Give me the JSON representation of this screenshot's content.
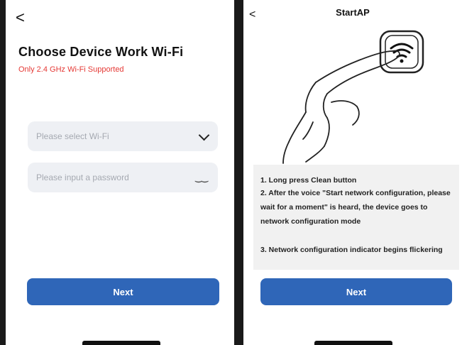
{
  "left_screen": {
    "back_label": "<",
    "title": "Choose Device Work Wi-Fi",
    "warning": "Only 2.4 GHz Wi-Fi Supported",
    "wifi_placeholder": "Please select Wi-Fi",
    "password_placeholder": "Please input a password",
    "eye_glyph": "‿‿",
    "next_label": "Next"
  },
  "right_screen": {
    "back_label": "<",
    "title": "StartAP",
    "instructions": [
      "1. Long press Clean button",
      "2. After the voice \"Start network configuration, please wait for a moment\" is heard, the device goes to network configuration mode",
      "3. Network configuration indicator begins flickering"
    ],
    "next_label": "Next"
  },
  "colors": {
    "primary_button": "#2f66b8",
    "warning_text": "#e53935",
    "field_bg": "#eef0f4"
  }
}
